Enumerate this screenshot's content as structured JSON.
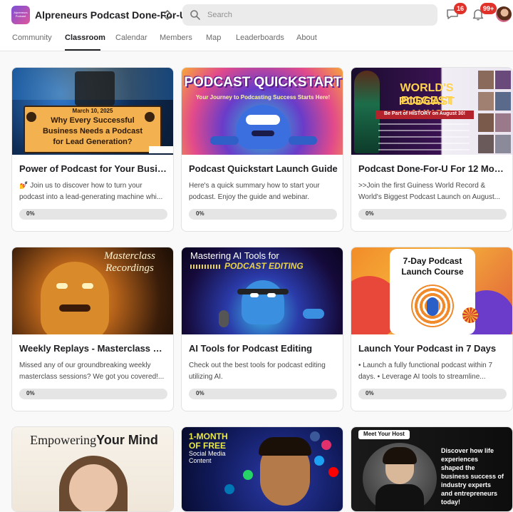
{
  "header": {
    "logo_text": "Alpreneurs Podcast",
    "group_name": "Alpreneurs Podcast Done-For-U",
    "search_placeholder": "Search",
    "chat_badge": "16",
    "notifications_badge": "99+"
  },
  "tabs": [
    {
      "label": "Community",
      "active": false
    },
    {
      "label": "Classroom",
      "active": true
    },
    {
      "label": "Calendar",
      "active": false
    },
    {
      "label": "Members",
      "active": false
    },
    {
      "label": "Map",
      "active": false
    },
    {
      "label": "Leaderboards",
      "active": false
    },
    {
      "label": "About",
      "active": false
    }
  ],
  "courses": [
    {
      "title": "Power of Podcast for Your Busine...",
      "desc_1": "💅 Join us to discover how to turn your",
      "desc_2": "podcast into a lead-generating machine whi...",
      "progress_label": "0%",
      "progress": 0,
      "thumb": {
        "date": "March 10, 2025",
        "headline_1": "Why Every Successful",
        "headline_2": "Business Needs a Podcast",
        "headline_3": "for Lead Generation?"
      }
    },
    {
      "title": "Podcast Quickstart Launch Guide",
      "desc_1": "Here's a quick summary how to start your",
      "desc_2": "podcast. Enjoy the guide and webinar.",
      "progress_label": "0%",
      "progress": 0,
      "thumb": {
        "headline_1": "PODCAST QUICKSTART",
        "headline_2": "Your Journey to Podcasting Success Starts Here!"
      }
    },
    {
      "title": "Podcast Done-For-U For 12 Months",
      "desc_1": ">>Join the first Guiness World Record &",
      "desc_2": "World's Biggest Podcast Launch on August...",
      "progress_label": "0%",
      "progress": 0,
      "thumb": {
        "headline_1": "WORLD'S BIGGEST",
        "headline_2": "PODCAST LAUNCH",
        "headline_3": "Be Part of HISTORY on August 30!"
      }
    },
    {
      "title": "Weekly Replays - Masterclass & S...",
      "desc_1": "Missed any of our groundbreaking weekly",
      "desc_2": "masterclass sessions? We got you covered!...",
      "progress_label": "0%",
      "progress": 0,
      "thumb": {
        "headline_1": "Masterclass",
        "headline_2": "Recordings"
      }
    },
    {
      "title": "AI Tools for Podcast Editing",
      "desc_1": "Check out the best tools for podcast editing",
      "desc_2": "utilizing AI.",
      "progress_label": "0%",
      "progress": 0,
      "thumb": {
        "headline_1": "Mastering AI Tools for",
        "headline_2": "PODCAST EDITING"
      }
    },
    {
      "title": "Launch Your Podcast in 7 Days",
      "desc_1": "• Launch a fully functional podcast within 7",
      "desc_2": "days. • Leverage AI tools to streamline...",
      "progress_label": "0%",
      "progress": 0,
      "thumb": {
        "headline_1": "7-Day Podcast",
        "headline_2": "Launch Course"
      }
    },
    {
      "thumb": {
        "headline_1": "Empowering",
        "headline_2": "Your Mind"
      }
    },
    {
      "thumb": {
        "headline_1": "1-MONTH",
        "headline_2": "OF FREE",
        "headline_3": "Social Media",
        "headline_4": "Content"
      }
    },
    {
      "thumb": {
        "tag": "Meet Your Host",
        "headline_1": "Discover how life",
        "headline_2": "experiences",
        "headline_3": "shaped the",
        "headline_4": "business success of",
        "headline_5": "industry experts",
        "headline_6": "and entrepreneurs",
        "headline_7": "today!"
      }
    }
  ],
  "colors": {
    "badge": "#e0322b",
    "progress_track": "#e5e5e5",
    "active_tab": "#202124"
  },
  "icons": [
    "search-icon",
    "chevron-updown-icon",
    "chat-icon",
    "bell-icon"
  ]
}
